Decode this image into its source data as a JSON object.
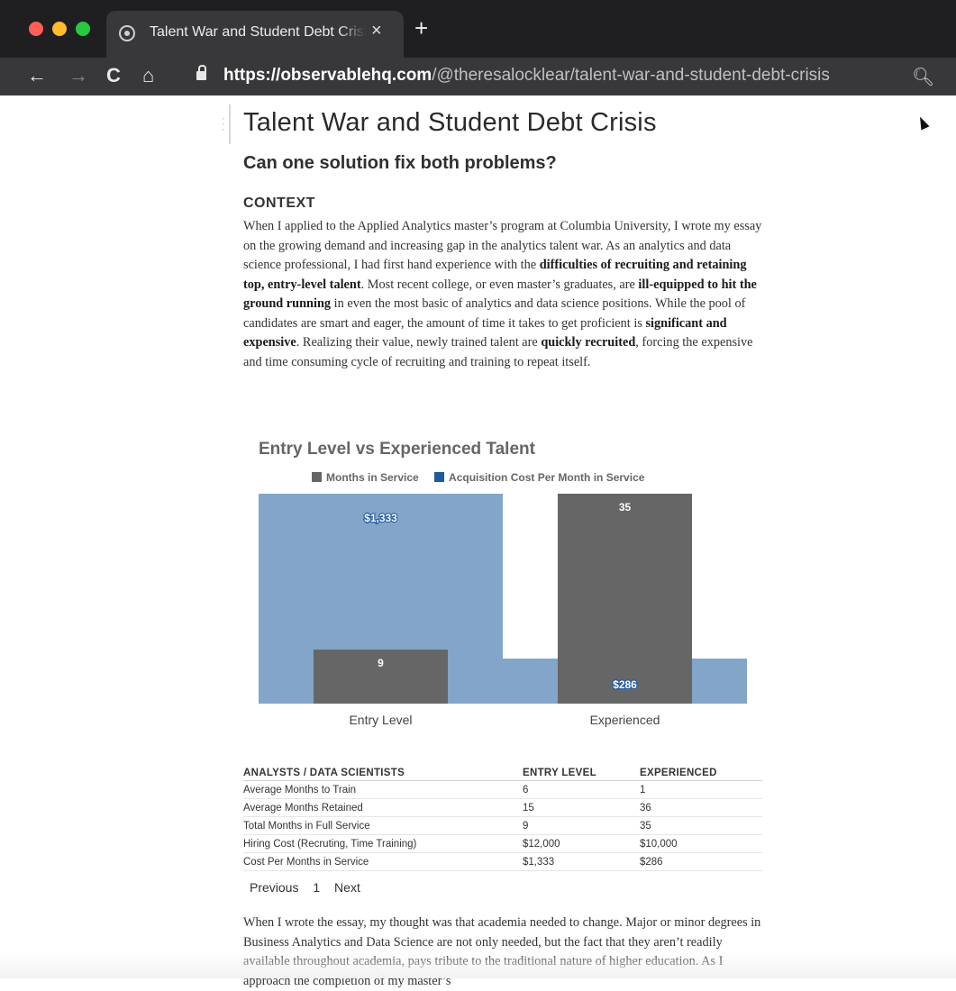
{
  "browser": {
    "tab_title": "Talent War and Student Debt Crisis",
    "new_tab_label": "+",
    "close_tab_label": "×",
    "url_host": "https://observablehq.com",
    "url_path": "/@theresalocklear/talent-war-and-student-debt-crisis",
    "traffic_colors": [
      "#ff5f57",
      "#febc2e",
      "#28c840"
    ]
  },
  "page": {
    "title": "Talent War and Student Debt Crisis",
    "subtitle": "Can one solution fix both problems?",
    "context_heading": "CONTEXT",
    "para1": [
      {
        "t": "When I applied to the Applied Analytics master’s program at Columbia University, I wrote my essay on the growing demand and increasing gap in the analytics talent war. As an analytics and data science professional, I had first hand experience with the ",
        "b": false
      },
      {
        "t": "difficulties of recruiting and retaining top, entry-level talent",
        "b": true
      },
      {
        "t": ". Most recent college, or even master’s graduates, are ",
        "b": false
      },
      {
        "t": "ill-equipped to hit the ground running",
        "b": true
      },
      {
        "t": " in even the most basic of analytics and data science positions. While the pool of candidates are smart and eager, the amount of time it takes to get proficient is ",
        "b": false
      },
      {
        "t": "significant and expensive",
        "b": true
      },
      {
        "t": ". Realizing their value, newly trained talent are ",
        "b": false
      },
      {
        "t": "quickly recruited",
        "b": true
      },
      {
        "t": ", forcing the expensive and time consuming cycle of recruiting and training to repeat itself.",
        "b": false
      }
    ],
    "para2": "When I wrote the essay, my thought was that academia needed to change. Major or minor degrees in Business Analytics and Data Science are not only needed, but the fact that they aren’t readily available throughout academia, pays tribute to the traditional nature of higher education. As I approach the completion of my master’s"
  },
  "chart_data": {
    "type": "bar",
    "title": "Entry Level vs Experienced Talent",
    "categories": [
      "Entry Level",
      "Experienced"
    ],
    "series": [
      {
        "name": "Months in Service",
        "values": [
          9,
          35
        ],
        "labels": [
          "9",
          "35"
        ],
        "color": "#666666"
      },
      {
        "name": "Acquisition Cost Per Month in Service",
        "values": [
          1333,
          286
        ],
        "labels": [
          "$1,333",
          "$286"
        ],
        "color": "#1f5b9e"
      }
    ],
    "legend": "top",
    "grid": false
  },
  "table": {
    "headers": [
      "ANALYSTS / DATA SCIENTISTS",
      "ENTRY LEVEL",
      "EXPERIENCED"
    ],
    "rows": [
      [
        "Average Months to Train",
        "6",
        "1"
      ],
      [
        "Average Months Retained",
        "15",
        "36"
      ],
      [
        "Total Months in Full Service",
        "9",
        "35"
      ],
      [
        "Hiring Cost (Recruting, Time Training)",
        "$12,000",
        "$10,000"
      ],
      [
        "Cost Per Months in Service",
        "$1,333",
        "$286"
      ]
    ]
  },
  "pager": {
    "previous": "Previous",
    "page": "1",
    "next": "Next"
  }
}
